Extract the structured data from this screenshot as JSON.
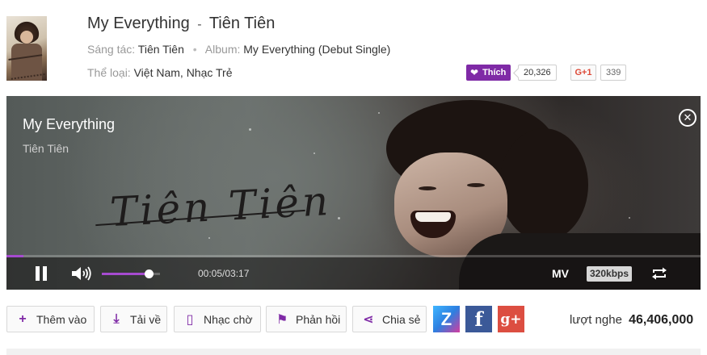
{
  "song": {
    "title": "My Everything",
    "separator": "-",
    "artist": "Tiên Tiên"
  },
  "meta": {
    "composer_label": "Sáng tác:",
    "composer": "Tiên Tiên",
    "album_label": "Album:",
    "album": "My Everything (Debut Single)",
    "genre_label": "Thể loại:",
    "genres": "Việt Nam, Nhạc Trẻ"
  },
  "social_counts": {
    "like_label": "Thích",
    "like_count": "20,326",
    "gplus_label": "G+1",
    "gplus_count": "339"
  },
  "player": {
    "title": "My Everything",
    "artist": "Tiên Tiên",
    "artwork_signature": "Tiên Tiên",
    "current_time": "00:05",
    "duration": "03:17",
    "time_display": "00:05/03:17",
    "progress_fraction": 0.025,
    "volume_fraction": 0.8,
    "mv_label": "MV",
    "quality_label": "320kbps",
    "accent_color": "#a64bd0"
  },
  "actions": {
    "add_label": "Thêm vào",
    "download_label": "Tải về",
    "ringtone_label": "Nhạc chờ",
    "feedback_label": "Phản hồi",
    "share_label": "Chia sẻ"
  },
  "share_icons": [
    "zing-icon",
    "facebook-icon",
    "google-plus-icon"
  ],
  "stats": {
    "listens_label": "lượt nghe",
    "listens_count": "46,406,000"
  },
  "colors": {
    "brand_purple": "#7f2aa6",
    "facebook": "#3b5998",
    "google_plus": "#dc4e41"
  }
}
